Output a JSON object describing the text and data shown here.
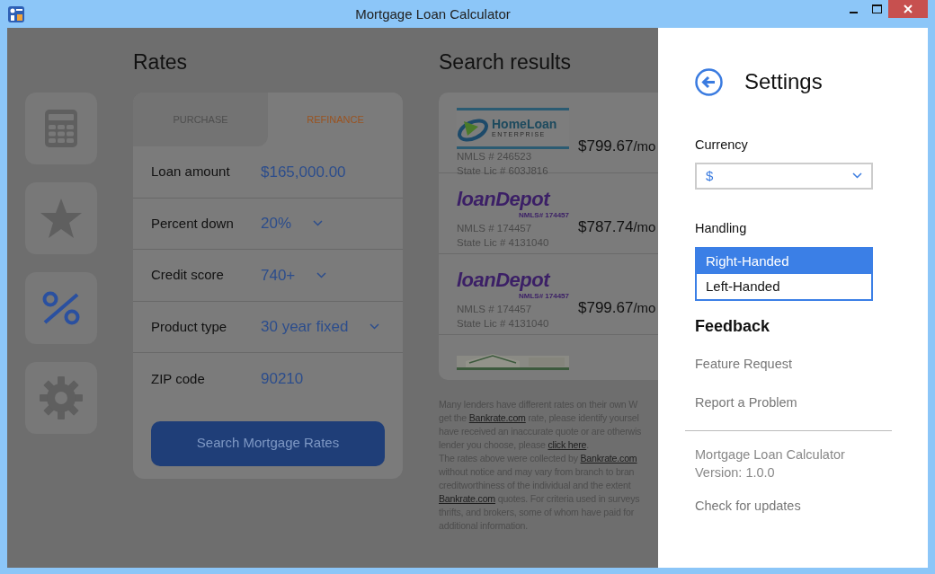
{
  "window": {
    "title": "Mortgage Loan Calculator"
  },
  "sidebar": {
    "items": [
      {
        "kind": "calculator",
        "selected": false
      },
      {
        "kind": "star",
        "selected": false
      },
      {
        "kind": "percent",
        "selected": true
      },
      {
        "kind": "gear",
        "selected": false
      }
    ]
  },
  "rates": {
    "heading": "Rates",
    "tabs": [
      {
        "label": "PURCHASE",
        "selected": false
      },
      {
        "label": "REFINANCE",
        "selected": true
      }
    ],
    "fields": [
      {
        "label": "Loan amount",
        "value": "$165,000.00",
        "kind": "text"
      },
      {
        "label": "Percent down",
        "value": "20%",
        "kind": "dropdown"
      },
      {
        "label": "Credit score",
        "value": "740+",
        "kind": "dropdown"
      },
      {
        "label": "Product type",
        "value": "30 year fixed",
        "kind": "dropdown"
      },
      {
        "label": "ZIP code",
        "value": "90210",
        "kind": "text"
      }
    ],
    "button": "Search Mortgage Rates"
  },
  "search_results": {
    "heading": "Search results",
    "results": [
      {
        "logo": {
          "kind": "homeloan",
          "text": "HomeLoan",
          "subtext": "ENTERPRISE"
        },
        "nmls": "NMLS # 246523",
        "license": "State Lic # 603J816",
        "payment": "$799.67",
        "unit": "/mo"
      },
      {
        "logo": {
          "kind": "loandepot",
          "text": "loanDepot",
          "subtext": "NMLS# 174457"
        },
        "nmls": "NMLS # 174457",
        "license": "State Lic # 4131040",
        "payment": "$787.74",
        "unit": "/mo"
      },
      {
        "logo": {
          "kind": "loandepot",
          "text": "loanDepot",
          "subtext": "NMLS# 174457"
        },
        "nmls": "NMLS # 174457",
        "license": "State Lic # 4131040",
        "payment": "$799.67",
        "unit": "/mo"
      },
      {
        "logo": {
          "kind": "picture"
        }
      }
    ],
    "disclaimer": [
      [
        {
          "text": "Many lenders have different rates on their own W"
        }
      ],
      [
        {
          "text": "get the "
        },
        {
          "text": "Bankrate.com",
          "link": true
        },
        {
          "text": " rate, please identify yoursel"
        }
      ],
      [
        {
          "text": "have received an inaccurate quote or are otherwis"
        }
      ],
      [
        {
          "text": "lender you choose, please "
        },
        {
          "text": "click here",
          "link": true
        },
        {
          "text": "."
        }
      ],
      [
        {
          "text": "The rates above were collected by "
        },
        {
          "text": "Bankrate.com",
          "link": true
        }
      ],
      [
        {
          "text": "without notice and may vary from branch to bran"
        }
      ],
      [
        {
          "text": "creditworthiness of the individual and the extent"
        }
      ],
      [
        {
          "text": "Bankrate.com",
          "link": true
        },
        {
          "text": " quotes. For criteria used in surveys"
        }
      ],
      [
        {
          "text": "thrifts, and brokers, some of whom have paid for"
        }
      ],
      [
        {
          "text": "additional information."
        }
      ]
    ]
  },
  "settings": {
    "title": "Settings",
    "currency": {
      "label": "Currency",
      "value": "$"
    },
    "handling": {
      "label": "Handling",
      "options": [
        {
          "label": "Right-Handed",
          "selected": true
        },
        {
          "label": "Left-Handed",
          "selected": false
        }
      ]
    },
    "feedback": {
      "heading": "Feedback",
      "links": [
        "Feature Request",
        "Report a Problem"
      ]
    },
    "about": {
      "app_name": "Mortgage Loan Calculator",
      "version": "Version: 1.0.0",
      "update_link": "Check for updates"
    }
  }
}
